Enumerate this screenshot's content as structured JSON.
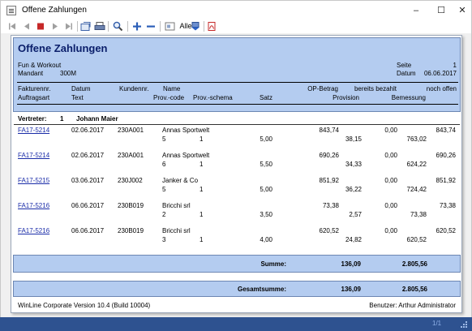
{
  "window": {
    "title": "Offene Zahlungen",
    "minimize": "–",
    "maximize": "☐",
    "close": "✕"
  },
  "toolbar": {
    "alle_label": "Alle"
  },
  "report": {
    "title": "Offene Zahlungen",
    "company": "Fun & Workout",
    "mandant_label": "Mandant",
    "mandant_value": "300M",
    "seite_label": "Seite",
    "seite_value": "1",
    "datum_label": "Datum",
    "datum_value": "06.06.2017",
    "columns": {
      "fakturennr": "Fakturennr.",
      "datum": "Datum",
      "kundennr": "Kundennr.",
      "name": "Name",
      "op_betrag": "OP-Betrag",
      "bereits_bezahlt": "bereits bezahlt",
      "noch_offen": "noch offen",
      "auftragsart": "Auftragsart",
      "text": "Text",
      "prov_code": "Prov.-code",
      "prov_schema": "Prov.-schema",
      "satz": "Satz",
      "provision": "Provision",
      "bemessung": "Bemessung"
    },
    "vertreter_label": "Vertreter:",
    "vertreter_nr": "1",
    "vertreter_name": "Johann Maier",
    "rows": [
      {
        "faktura": "FA17-5214",
        "datum": "02.06.2017",
        "kunde": "230A001",
        "name": "Annas Sportwelt",
        "auftragsart": "5",
        "prov_code": "1",
        "satz": "5,00",
        "op_betrag": "843,74",
        "bezahlt": "0,00",
        "offen": "843,74",
        "provision": "38,15",
        "bemessung": "763,02"
      },
      {
        "faktura": "FA17-5214",
        "datum": "02.06.2017",
        "kunde": "230A001",
        "name": "Annas Sportwelt",
        "auftragsart": "6",
        "prov_code": "1",
        "satz": "5,50",
        "op_betrag": "690,26",
        "bezahlt": "0,00",
        "offen": "690,26",
        "provision": "34,33",
        "bemessung": "624,22"
      },
      {
        "faktura": "FA17-5215",
        "datum": "03.06.2017",
        "kunde": "230J002",
        "name": "Janker & Co",
        "auftragsart": "5",
        "prov_code": "1",
        "satz": "5,00",
        "op_betrag": "851,92",
        "bezahlt": "0,00",
        "offen": "851,92",
        "provision": "36,22",
        "bemessung": "724,42"
      },
      {
        "faktura": "FA17-5216",
        "datum": "06.06.2017",
        "kunde": "230B019",
        "name": "Bricchi srl",
        "auftragsart": "2",
        "prov_code": "1",
        "satz": "3,50",
        "op_betrag": "73,38",
        "bezahlt": "0,00",
        "offen": "73,38",
        "provision": "2,57",
        "bemessung": "73,38"
      },
      {
        "faktura": "FA17-5216",
        "datum": "06.06.2017",
        "kunde": "230B019",
        "name": "Bricchi srl",
        "auftragsart": "3",
        "prov_code": "1",
        "satz": "4,00",
        "op_betrag": "620,52",
        "bezahlt": "0,00",
        "offen": "620,52",
        "provision": "24,82",
        "bemessung": "620,52"
      }
    ],
    "summe_label": "Summe:",
    "summe_provision": "136,09",
    "summe_bemessung": "2.805,56",
    "gesamt_label": "Gesamtsumme:",
    "gesamt_provision": "136,09",
    "gesamt_bemessung": "2.805,56",
    "footer_version": "WinLine Corporate Version 10.4 (Build 10004)",
    "footer_user": "Benutzer: Arthur Administrator"
  },
  "statusbar": {
    "page_indicator": "1/1"
  },
  "colors": {
    "header_band": "#b4ccf0",
    "status_bar": "#2e5290",
    "title_text": "#0a1e6a",
    "link": "#1a2ca8"
  }
}
